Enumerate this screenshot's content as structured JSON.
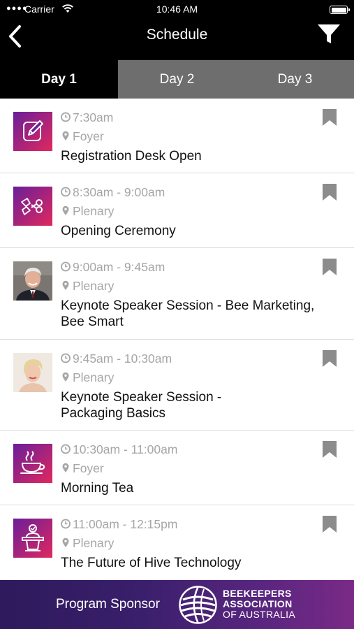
{
  "status_bar": {
    "carrier": "Carrier",
    "time": "10:46 AM"
  },
  "nav": {
    "title": "Schedule"
  },
  "tabs": [
    {
      "label": "Day 1",
      "active": true
    },
    {
      "label": "Day 2",
      "active": false
    },
    {
      "label": "Day 3",
      "active": false
    }
  ],
  "sessions": [
    {
      "time": "7:30am",
      "location": "Foyer",
      "title": "Registration Desk Open",
      "icon": "pencil-edit-icon"
    },
    {
      "time": "8:30am - 9:00am",
      "location": "Plenary",
      "title": "Opening Ceremony",
      "icon": "ribbon-cutting-icon"
    },
    {
      "time": "9:00am - 9:45am",
      "location": "Plenary",
      "title": "Keynote Speaker Session - Bee Marketing, Bee Smart",
      "icon": "speaker-photo-man"
    },
    {
      "time": "9:45am - 10:30am",
      "location": "Plenary",
      "title": "Keynote Speaker Session - Packaging Basics",
      "icon": "speaker-photo-woman"
    },
    {
      "time": "10:30am - 11:00am",
      "location": "Foyer",
      "title": "Morning Tea",
      "icon": "coffee-cup-icon"
    },
    {
      "time": "11:00am - 12:15pm",
      "location": "Plenary",
      "title": "The Future of Hive Technology",
      "icon": "podium-speaker-icon"
    }
  ],
  "sponsor": {
    "label": "Program Sponsor",
    "org_line1": "BEEKEEPERS",
    "org_line2": "ASSOCIATION",
    "org_line3": "OF AUSTRALIA"
  },
  "colors": {
    "tab_active": "#000000",
    "tab_inactive": "#6e6e6e",
    "icon_gradient_start": "#6a1e9a",
    "icon_gradient_end": "#e0285e",
    "meta_text": "#a6a6a6",
    "bookmark": "#8c8c8c"
  }
}
